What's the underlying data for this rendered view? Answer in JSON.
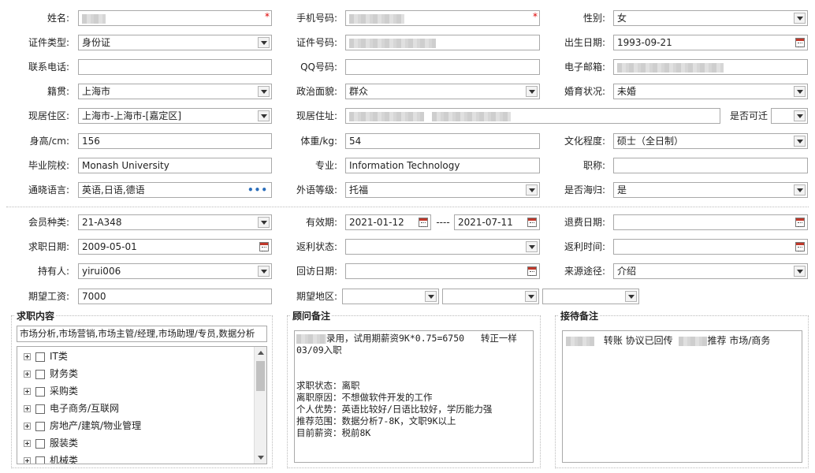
{
  "labels": {
    "name": "姓名:",
    "phone": "手机号码:",
    "gender": "性别:",
    "id_type": "证件类型:",
    "id_no": "证件号码:",
    "birth": "出生日期:",
    "contact": "联系电话:",
    "qq": "QQ号码:",
    "email": "电子邮箱:",
    "native": "籍贯:",
    "politics": "政治面貌:",
    "marital": "婚育状况:",
    "residence_area": "现居住区:",
    "residence_addr": "现居住址:",
    "relocate": "是否可迁",
    "height": "身高/cm:",
    "weight": "体重/kg:",
    "education": "文化程度:",
    "school": "毕业院校:",
    "major": "专业:",
    "title": "职称:",
    "languages": "通晓语言:",
    "lang_level": "外语等级:",
    "returnee": "是否海归:",
    "member_type": "会员种类:",
    "valid_period": "有效期:",
    "refund_date": "退费日期:",
    "job_date": "求职日期:",
    "rebate_status": "返利状态:",
    "rebate_time": "返利时间:",
    "holder": "持有人:",
    "visit_date": "回访日期:",
    "source": "来源途径:",
    "expected_salary": "期望工资:",
    "expected_region": "期望地区:",
    "period_sep": "----"
  },
  "values": {
    "gender": "女",
    "id_type": "身份证",
    "birth": "1993-09-21",
    "native": "上海市",
    "politics": "群众",
    "marital": "未婚",
    "residence_area": "上海市-上海市-[嘉定区]",
    "height": "156",
    "weight": "54",
    "education": "硕士（全日制）",
    "school": "Monash University",
    "major": "Information Technology",
    "title": "",
    "languages": "英语,日语,德语",
    "lang_level": "托福",
    "returnee": "是",
    "member_type": "21-A348",
    "valid_from": "2021-01-12",
    "valid_to": "2021-07-11",
    "job_date": "2009-05-01",
    "holder": "yirui006",
    "source": "介绍",
    "expected_salary": "7000"
  },
  "panels": {
    "job_content": {
      "title": "求职内容",
      "summary": "市场分析,市场营销,市场主管/经理,市场助理/专员,数据分析",
      "tree": [
        "IT类",
        "财务类",
        "采购类",
        "电子商务/互联网",
        "房地产/建筑/物业管理",
        "服装类",
        "机械类"
      ]
    },
    "advisor_notes": {
      "title": "顾问备注",
      "line1_suffix": "录用，试用期薪资9K*0.75=6750   转正一样",
      "line2": "03/09入职",
      "lines": [
        "求职状态：离职",
        "离职原因：不想做软件开发的工作",
        "个人优势：英语比较好/日语比较好，学历能力强",
        "推荐范围：数据分析7-8K，文职9K以上",
        "目前薪资：税前8K"
      ]
    },
    "reception_notes": {
      "title": "接待备注",
      "part1": "转账 协议已回传",
      "part2": "推荐 市场/商务"
    }
  },
  "icons": {
    "dropdown": "chevron-down-icon",
    "calendar": "calendar-icon",
    "more": "ellipsis-icon",
    "expand": "plus-expand-icon",
    "checkbox": "checkbox-icon",
    "required": "asterisk-icon"
  },
  "colors": {
    "required": "#dd0000",
    "more_dots": "#2a6ebb",
    "calendar_top": "#c0392b"
  }
}
